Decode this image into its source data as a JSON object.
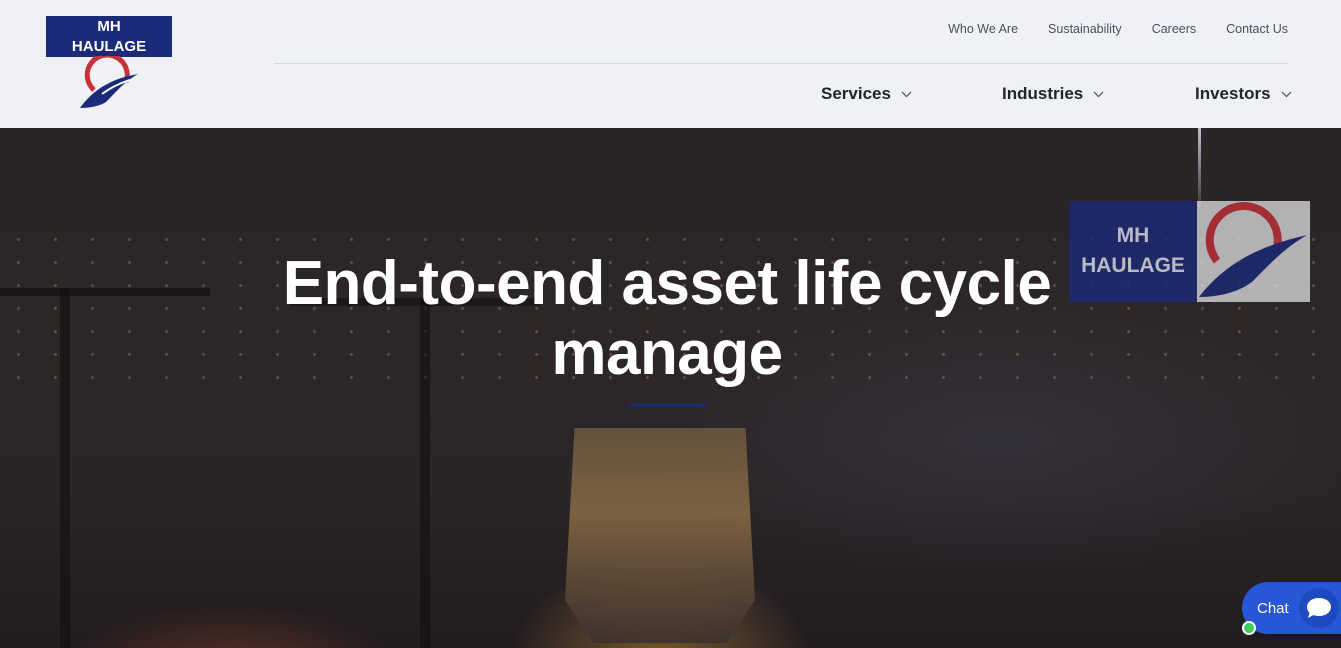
{
  "brand": {
    "line1": "MH",
    "line2": "HAULAGE"
  },
  "top_nav": [
    "Who We Are",
    "Sustainability",
    "Careers",
    "Contact Us"
  ],
  "main_nav": [
    {
      "label": "Services",
      "icon": "chevron-down-icon"
    },
    {
      "label": "Industries",
      "icon": "chevron-down-icon"
    },
    {
      "label": "Investors",
      "icon": "chevron-down-icon"
    }
  ],
  "hero": {
    "title": "End-to-end asset life cycle manage",
    "watermark_line1": "MH",
    "watermark_line2": "HAULAGE"
  },
  "chat": {
    "label": "Chat",
    "icon": "chat-bubble-icon",
    "status": "online"
  },
  "colors": {
    "brand_navy": "#1c2a7a",
    "brand_red": "#c8313a",
    "chat_blue": "#2757d6",
    "online_green": "#3ccf5a"
  }
}
